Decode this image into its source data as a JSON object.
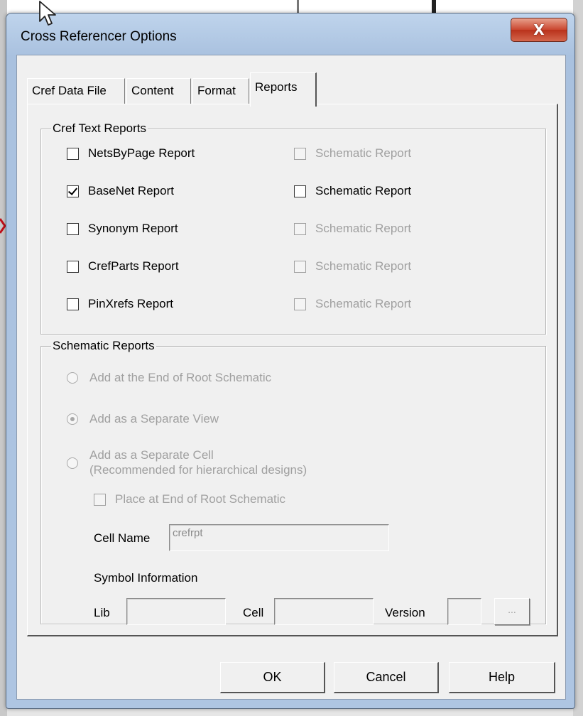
{
  "window": {
    "title": "Cross Referencer Options",
    "close_glyph": "X"
  },
  "tabs": [
    {
      "label": "Cref Data File"
    },
    {
      "label": "Content"
    },
    {
      "label": "Format"
    },
    {
      "label": "Reports",
      "active": true
    }
  ],
  "cref_text_reports": {
    "title": "Cref Text Reports",
    "rows": [
      {
        "report": "NetsByPage Report",
        "report_checked": false,
        "schematic": "Schematic Report",
        "schematic_checked": false,
        "schematic_enabled": false
      },
      {
        "report": "BaseNet Report",
        "report_checked": true,
        "schematic": "Schematic Report",
        "schematic_checked": false,
        "schematic_enabled": true
      },
      {
        "report": "Synonym Report",
        "report_checked": false,
        "schematic": "Schematic Report",
        "schematic_checked": false,
        "schematic_enabled": false
      },
      {
        "report": "CrefParts Report",
        "report_checked": false,
        "schematic": "Schematic Report",
        "schematic_checked": false,
        "schematic_enabled": false
      },
      {
        "report": "PinXrefs Report",
        "report_checked": false,
        "schematic": "Schematic Report",
        "schematic_checked": false,
        "schematic_enabled": false
      }
    ]
  },
  "schematic_reports": {
    "title": "Schematic Reports",
    "radio_end_root": "Add at the End of Root Schematic",
    "radio_separate_view": "Add as a Separate View",
    "radio_separate_cell": "Add as a Separate Cell",
    "radio_separate_cell_note": "(Recommended for hierarchical designs)",
    "selected_option": "Add as a Separate View",
    "place_end_root": "Place at End of Root Schematic",
    "cell_name_label": "Cell Name",
    "cell_name_value": "crefrpt",
    "symbol_info_label": "Symbol Information",
    "lib_label": "Lib",
    "lib_value": "",
    "cell_label": "Cell",
    "cell_value": "",
    "version_label": "Version",
    "version_value": "",
    "browse_label": "..."
  },
  "buttons": {
    "ok": "OK",
    "cancel": "Cancel",
    "help": "Help"
  },
  "colors": {
    "titlebar": "#bfd4ec",
    "close": "#c9452e",
    "dialog_bg": "#f0f0f0",
    "disabled_text": "#a0a0a0"
  },
  "icons": {
    "cursor": "mouse-pointer-icon",
    "close": "close-icon"
  }
}
